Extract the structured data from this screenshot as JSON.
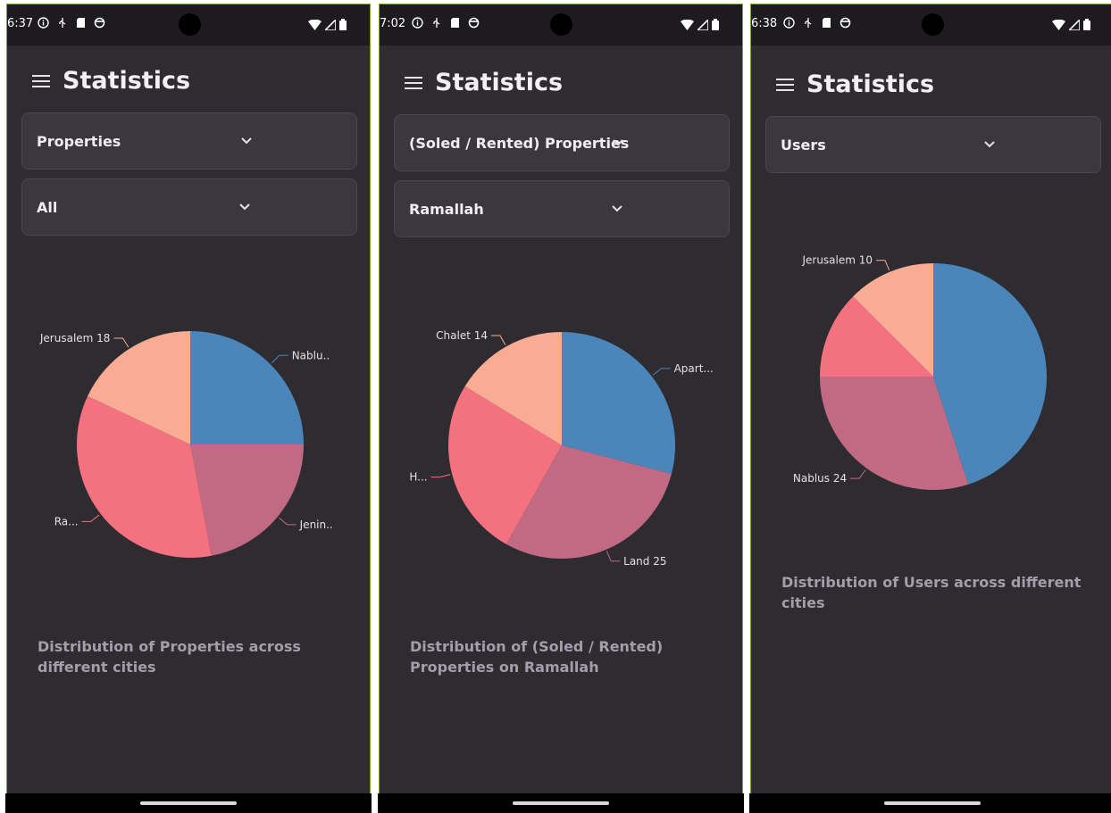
{
  "colors": {
    "background": "#2e2b31",
    "status_bar": "#1d1b20",
    "dropdown": "#3b3741",
    "caption": "#a39eab",
    "slice_1": "#4b86bb",
    "slice_2": "#c26a84",
    "slice_3": "#f47280",
    "slice_4": "#f7ac93",
    "leader": "#f7ac93"
  },
  "screens": [
    {
      "status_time": "6:37",
      "title": "Statistics",
      "dropdowns": [
        {
          "value": "Properties"
        },
        {
          "value": "All"
        }
      ],
      "caption": "Distribution of Properties across different cities",
      "chart_data": {
        "type": "pie",
        "slices": [
          {
            "label": "Nablu..",
            "value": 25
          },
          {
            "label": "Jenin..",
            "value": 22
          },
          {
            "label": "Ra...",
            "value": 35
          },
          {
            "label": "Jerusalem 18",
            "value": 18
          }
        ]
      }
    },
    {
      "status_time": "7:02",
      "title": "Statistics",
      "dropdowns": [
        {
          "value": "(Soled / Rented) Properties"
        },
        {
          "value": "Ramallah"
        }
      ],
      "caption": "Distribution of (Soled / Rented) Properties on Ramallah",
      "chart_data": {
        "type": "pie",
        "slices": [
          {
            "label": "Apart...",
            "value": 25
          },
          {
            "label": "Land 25",
            "value": 25
          },
          {
            "label": "H...",
            "value": 22
          },
          {
            "label": "Chalet 14",
            "value": 14
          }
        ]
      }
    },
    {
      "status_time": "6:38",
      "title": "Statistics",
      "dropdowns": [
        {
          "value": "Users"
        }
      ],
      "caption": "Distribution of Users across different cities",
      "chart_data": {
        "type": "pie",
        "slices": [
          {
            "label": "",
            "value": 36
          },
          {
            "label": "Nablus 24",
            "value": 24
          },
          {
            "label": "",
            "value": 10
          },
          {
            "label": "Jerusalem 10",
            "value": 10
          }
        ]
      }
    }
  ]
}
